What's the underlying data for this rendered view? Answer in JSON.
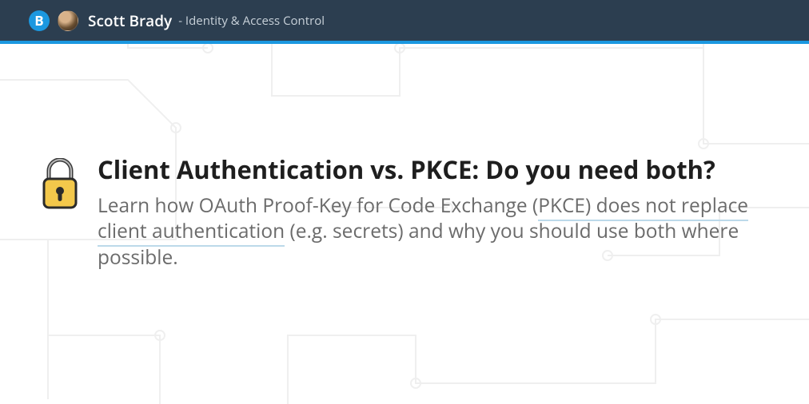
{
  "header": {
    "logo_letter": "B",
    "brand": "Scott Brady",
    "tagline": "- Identity & Access Control"
  },
  "article": {
    "icon": "lock-icon",
    "title": "Client Authentication vs. PKCE: Do you need both?",
    "summary_parts": {
      "p1": "Learn how OAuth Proof-Key for Code Exchange (",
      "u1": "PKCE) does not replace client authentication",
      "p2": " (e.g. secrets) and why you should use both where possible."
    }
  },
  "colors": {
    "header_bg": "#2c3e50",
    "accent": "#1b98e0",
    "title": "#1e1e1e",
    "body_text": "#6b6b6b",
    "underline": "#bcd9ea"
  }
}
